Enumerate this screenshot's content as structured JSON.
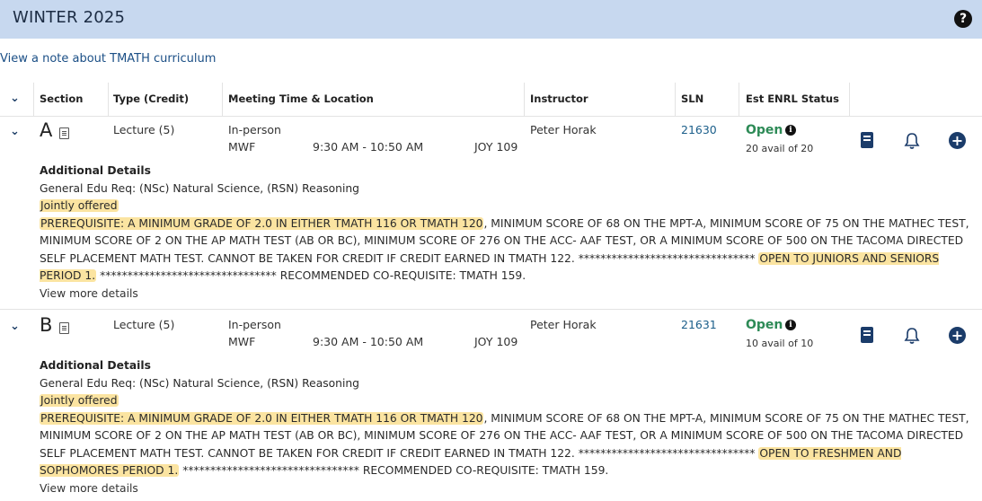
{
  "term": {
    "title": "WINTER 2025",
    "help_glyph": "?"
  },
  "note_link": "View a note about TMATH curriculum",
  "columns": [
    "Section",
    "Type (Credit)",
    "Meeting Time & Location",
    "Instructor",
    "SLN",
    "Est ENRL Status"
  ],
  "sections": [
    {
      "letter": "A",
      "type": "Lecture (5)",
      "mode": "In-person",
      "days": "MWF",
      "time": "9:30 AM - 10:50 AM",
      "room": "JOY 109",
      "instructor": "Peter Horak",
      "sln": "21630",
      "status": "Open",
      "avail": "20 avail of 20",
      "details_title": "Additional Details",
      "gen_ed": "General Edu Req: (NSc) Natural Science, (RSN) Reasoning",
      "jointly": "Jointly offered",
      "prereq": "PREREQUISITE: A MINIMUM GRADE OF 2.0 IN EITHER TMATH 116 OR TMATH 120",
      "body": ", MINIMUM SCORE OF 68 ON THE MPT-A, MINIMUM SCORE OF 75 ON THE MATHEC TEST, MINIMUM SCORE OF 2 ON THE AP MATH TEST (AB OR BC), MINIMUM SCORE OF 276 ON THE ACC- AAF TEST, OR A MINIMUM SCORE OF 500 ON THE TACOMA DIRECTED SELF PLACEMENT MATH TEST. CANNOT BE TAKEN FOR CREDIT IF CREDIT EARNED IN TMATH 122. ******************************** ",
      "open_to": "OPEN TO JUNIORS AND SENIORS PERIOD 1.",
      "tail": " ******************************** RECOMMENDED CO-REQUISITE: TMATH 159.",
      "more": "View more details"
    },
    {
      "letter": "B",
      "type": "Lecture (5)",
      "mode": "In-person",
      "days": "MWF",
      "time": "9:30 AM - 10:50 AM",
      "room": "JOY 109",
      "instructor": "Peter Horak",
      "sln": "21631",
      "status": "Open",
      "avail": "10 avail of 10",
      "details_title": "Additional Details",
      "gen_ed": "General Edu Req: (NSc) Natural Science, (RSN) Reasoning",
      "jointly": "Jointly offered",
      "prereq": "PREREQUISITE: A MINIMUM GRADE OF 2.0 IN EITHER TMATH 116 OR TMATH 120",
      "body": ", MINIMUM SCORE OF 68 ON THE MPT-A, MINIMUM SCORE OF 75 ON THE MATHEC TEST, MINIMUM SCORE OF 2 ON THE AP MATH TEST (AB OR BC), MINIMUM SCORE OF 276 ON THE ACC- AAF TEST, OR A MINIMUM SCORE OF 500 ON THE TACOMA DIRECTED SELF PLACEMENT MATH TEST. CANNOT BE TAKEN FOR CREDIT IF CREDIT EARNED IN TMATH 122. ******************************** ",
      "open_to": "OPEN TO FRESHMEN AND SOPHOMORES PERIOD 1.",
      "tail": " ******************************** RECOMMENDED CO-REQUISITE: TMATH 159.",
      "more": "View more details"
    }
  ],
  "icons": {
    "help": "help-circle-icon",
    "info": "info-icon",
    "textbook": "book-icon",
    "notify": "bell-icon",
    "add": "plus-circle-icon",
    "expand": "chevron-down-icon",
    "section_doc": "document-icon"
  },
  "colors": {
    "term_bar": "#c7d8ef",
    "open_status": "#2e8b57",
    "highlight": "#fbe4a1",
    "link": "#1b5e8a",
    "icon_navy": "#1b3c6a"
  }
}
